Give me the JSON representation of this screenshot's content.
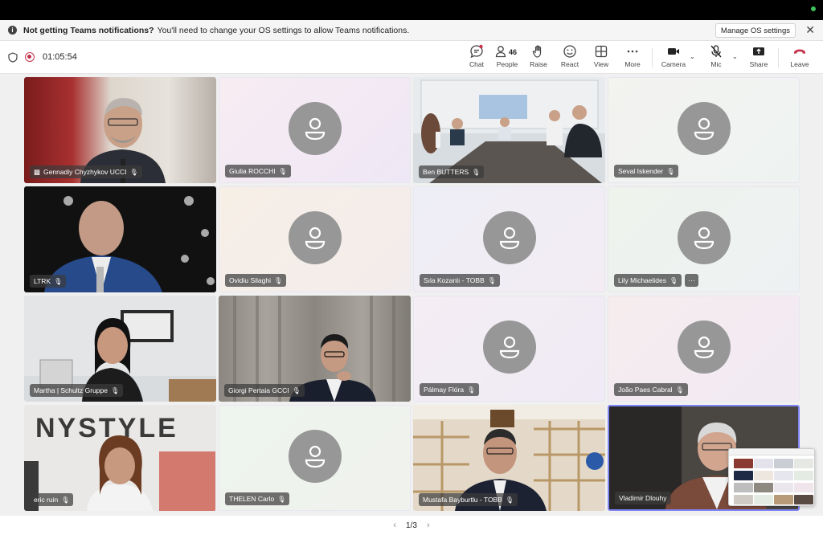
{
  "notification": {
    "bold": "Not getting Teams notifications?",
    "text": "You'll need to change your OS settings to allow Teams notifications.",
    "manage_label": "Manage OS settings",
    "close_glyph": "✕"
  },
  "meeting": {
    "timer": "01:05:54"
  },
  "toolbar": {
    "chat": "Chat",
    "people": "People",
    "people_count": "46",
    "raise": "Raise",
    "react": "React",
    "view": "View",
    "more": "More",
    "camera": "Camera",
    "mic": "Mic",
    "share": "Share",
    "leave": "Leave",
    "leave_color": "#c4314b"
  },
  "participants": [
    {
      "name": "Gennadiy Chyzhykov UCCI",
      "video": true
    },
    {
      "name": "Giulia ROCCHI",
      "video": false
    },
    {
      "name": "Ben BUTTERS",
      "video": true
    },
    {
      "name": "Seval Iskender",
      "video": false
    },
    {
      "name": "LTRK",
      "video": true
    },
    {
      "name": "Ovidiu Silaghi",
      "video": false
    },
    {
      "name": "Sıla Kozanlı - TOBB",
      "video": false
    },
    {
      "name": "Lily Michaelides",
      "video": false
    },
    {
      "name": "Martha | Schultz Gruppe",
      "video": true
    },
    {
      "name": "Giorgi Pertaia GCCI",
      "video": true
    },
    {
      "name": "Pálmay Flóra",
      "video": false
    },
    {
      "name": "João Paes Cabral",
      "video": false
    },
    {
      "name": "eric ruin",
      "video": true
    },
    {
      "name": "THELEN Carlo",
      "video": false
    },
    {
      "name": "Mustafa Bayburtlu - TOBB",
      "video": true
    },
    {
      "name": "Vladimir Dlouhy",
      "video": true
    }
  ],
  "more_glyph": "···",
  "mic_glyph": "🎙",
  "pager": {
    "current": "1/3",
    "prev": "‹",
    "next": "›"
  }
}
